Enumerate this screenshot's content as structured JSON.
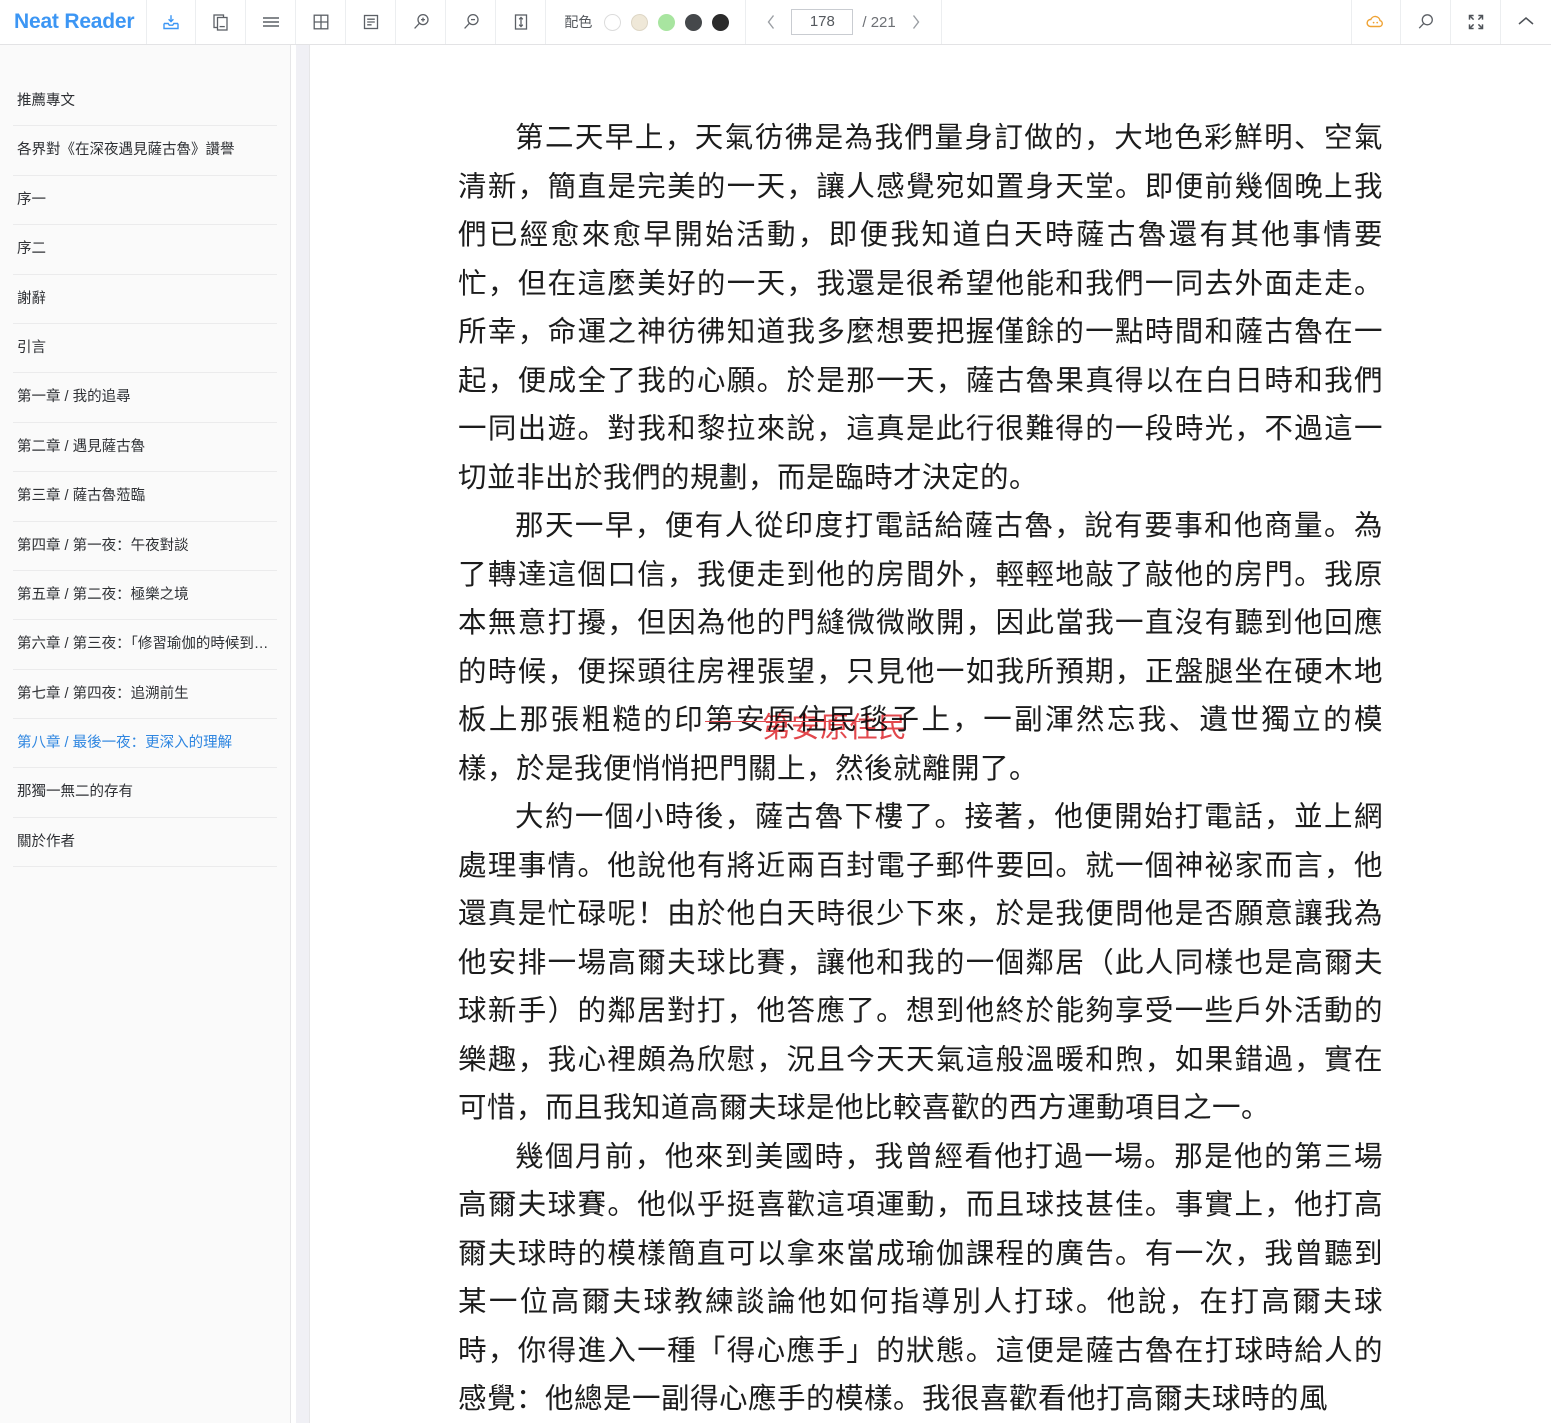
{
  "app": {
    "name": "Neat Reader",
    "brand_color": "#3c96f4"
  },
  "toolbar": {
    "icons": [
      {
        "name": "save-to-bookshelf-icon",
        "title": "save"
      },
      {
        "name": "copy-icon",
        "title": "copy"
      },
      {
        "name": "menu-icon",
        "title": "menu"
      },
      {
        "name": "grid-layout-icon",
        "title": "grid"
      },
      {
        "name": "single-page-icon",
        "title": "page"
      },
      {
        "name": "zoom-in-icon",
        "title": "zoom in"
      },
      {
        "name": "zoom-out-icon",
        "title": "zoom out"
      },
      {
        "name": "fit-height-icon",
        "title": "fit height"
      }
    ],
    "scheme": {
      "label": "配色",
      "swatches": [
        {
          "name": "scheme-white",
          "color": "#ffffff"
        },
        {
          "name": "scheme-sepia",
          "color": "#efe8d8"
        },
        {
          "name": "scheme-green",
          "color": "#a8e5a0"
        },
        {
          "name": "scheme-dark-gray",
          "color": "#45484b"
        },
        {
          "name": "scheme-black",
          "color": "#2b2b2b"
        }
      ]
    },
    "pager": {
      "prev_label": "‹",
      "next_label": "›",
      "current_page": "178",
      "current_page_placeholder": "178",
      "total_label": "/ 221"
    },
    "right_icons": [
      {
        "name": "cloud-sync-icon",
        "color": "#f0a030"
      },
      {
        "name": "search-icon",
        "color": "#5c6066"
      },
      {
        "name": "fullscreen-icon",
        "color": "#5c6066"
      },
      {
        "name": "collapse-toolbar-icon",
        "color": "#5c6066"
      }
    ]
  },
  "sidebar": {
    "items": [
      {
        "label": "推薦專文",
        "active": false
      },
      {
        "label": "各界對《在深夜遇見薩古魯》讚譽",
        "active": false
      },
      {
        "label": "序一",
        "active": false
      },
      {
        "label": "序二",
        "active": false
      },
      {
        "label": "謝辭",
        "active": false
      },
      {
        "label": "引言",
        "active": false
      },
      {
        "label": "第一章 / 我的追尋",
        "active": false
      },
      {
        "label": "第二章 / 遇見薩古魯",
        "active": false
      },
      {
        "label": "第三章 / 薩古魯蒞臨",
        "active": false
      },
      {
        "label": "第四章 / 第一夜：午夜對談",
        "active": false
      },
      {
        "label": "第五章 / 第二夜：極樂之境",
        "active": false
      },
      {
        "label": "第六章 / 第三夜：「修習瑜伽的時候到…",
        "active": false
      },
      {
        "label": "第七章 / 第四夜：追溯前生",
        "active": false
      },
      {
        "label": "第八章 / 最後一夜：更深入的理解",
        "active": true
      },
      {
        "label": "那獨一無二的存有",
        "active": false
      },
      {
        "label": "關於作者",
        "active": false
      }
    ]
  },
  "content": {
    "paragraphs": [
      "第二天早上，天氣彷彿是為我們量身訂做的，大地色彩鮮明、空氣清新，簡直是完美的一天，讓人感覺宛如置身天堂。即便前幾個晚上我們已經愈來愈早開始活動，即便我知道白天時薩古魯還有其他事情要忙，但在這麼美好的一天，我還是很希望他能和我們一同去外面走走。所幸，命運之神彷彿知道我多麼想要把握僅餘的一點時間和薩古魯在一起，便成全了我的心願。於是那一天，薩古魯果真得以在白日時和我們一同出遊。對我和黎拉來說，這真是此行很難得的一段時光，不過這一切並非出於我們的規劃，而是臨時才決定的。",
      "那天一早，便有人從印度打電話給薩古魯，說有要事和他商量。為了轉達這個口信，我便走到他的房間外，輕輕地敲了敲他的房門。我原本無意打擾，但因為他的門縫微微敞開，因此當我一直沒有聽到他回應的時候，便探頭往房裡張望，只見他一如我所預期，正盤腿坐在硬木地板上那張粗糙的印第安原住民毯子上，一副渾然忘我、遺世獨立的模樣，於是我便悄悄把門關上，然後就離開了。",
      "大約一個小時後，薩古魯下樓了。接著，他便開始打電話，並上網處理事情。他說他有將近兩百封電子郵件要回。就一個神祕家而言，他還真是忙碌呢！由於他白天時很少下來，於是我便問他是否願意讓我為他安排一場高爾夫球比賽，讓他和我的一個鄰居（此人同樣也是高爾夫球新手）的鄰居對打，他答應了。想到他終於能夠享受一些戶外活動的樂趣，我心裡頗為欣慰，況且今天天氣這般溫暖和煦，如果錯過，實在可惜，而且我知道高爾夫球是他比較喜歡的西方運動項目之一。",
      "幾個月前，他來到美國時，我曾經看他打過一場。那是他的第三場高爾夫球賽。他似乎挺喜歡這項運動，而且球技甚佳。事實上，他打高爾夫球時的模樣簡直可以拿來當成瑜伽課程的廣告。有一次，我曾聽到某一位高爾夫球教練談論他如何指導別人打球。他說，在打高爾夫球時，你得進入一種「得心應手」的狀態。這便是薩古魯在打球時給人的感覺：他總是一副得心應手的模樣。我很喜歡看他打高爾夫球時的風"
    ],
    "annotation": {
      "struck_text": "第安原住民",
      "overlay_text": "第安原住民",
      "color": "#e2474c"
    }
  }
}
